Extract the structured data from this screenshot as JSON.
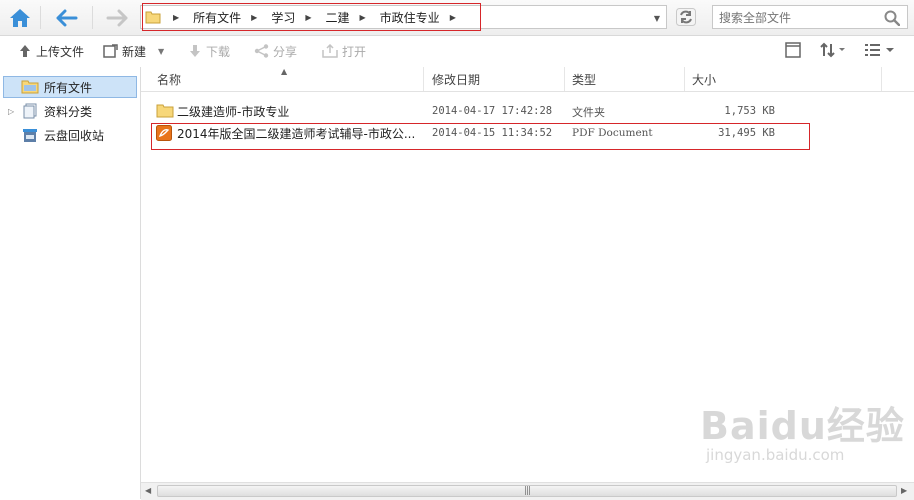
{
  "address_bar": {
    "crumbs": [
      "所有文件",
      "学习",
      "二建",
      "市政住专业"
    ]
  },
  "search": {
    "placeholder": "搜索全部文件"
  },
  "toolbar": {
    "upload": "上传文件",
    "new": "新建",
    "download": "下载",
    "share": "分享",
    "open": "打开"
  },
  "sidebar": {
    "items": [
      {
        "label": "所有文件"
      },
      {
        "label": "资料分类"
      },
      {
        "label": "云盘回收站"
      }
    ]
  },
  "columns": {
    "name": "名称",
    "modified": "修改日期",
    "type": "类型",
    "size": "大小"
  },
  "files": [
    {
      "name": "二级建造师-市政专业",
      "modified": "2014-04-17 17:42:28",
      "type": "文件夹",
      "size": "1,753 KB",
      "icon": "folder-icon"
    },
    {
      "name": "2014年版全国二级建造师考试辅导-市政公...",
      "modified": "2014-04-15 11:34:52",
      "type": "PDF Document",
      "size": "31,495 KB",
      "icon": "pdf-icon"
    }
  ],
  "watermark": {
    "brand": "Baidu经验",
    "url": "jingyan.baidu.com"
  },
  "colors": {
    "accent": "#3a8fd8",
    "highlight": "#d6262a",
    "selection": "#cde3f8"
  }
}
